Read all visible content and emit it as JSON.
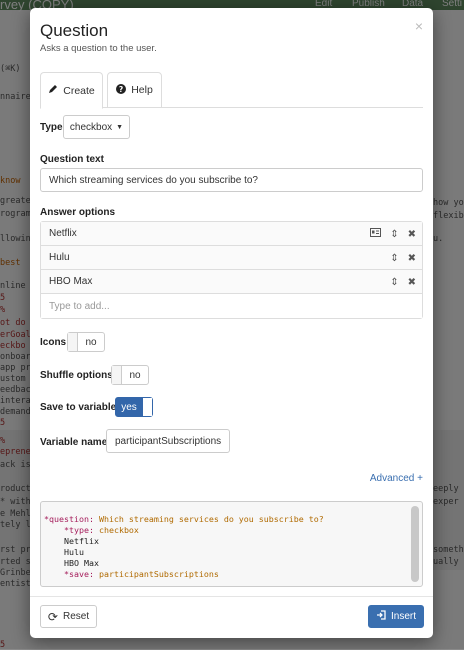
{
  "background": {
    "title": "rvey (COPY)",
    "nav": [
      "Edit",
      "Publish",
      "Data",
      "Setti"
    ],
    "shortcut": "(⌘K)",
    "fragments": [
      {
        "text": "nnaire",
        "cls": ""
      },
      {
        "text": "know",
        "cls": "orange"
      },
      {
        "text": "greate",
        "cls": ""
      },
      {
        "text": "rogram",
        "cls": ""
      },
      {
        "text": "llowin",
        "cls": ""
      },
      {
        "text": "best",
        "cls": "orange"
      },
      {
        "text": "nline",
        "cls": ""
      },
      {
        "text": "5",
        "cls": "red"
      },
      {
        "text": "%",
        "cls": "red"
      },
      {
        "text": "ot do",
        "cls": "red"
      },
      {
        "text": "erGoal",
        "cls": "red"
      },
      {
        "text": "eckbo",
        "cls": "red"
      },
      {
        "text": "onboar",
        "cls": ""
      },
      {
        "text": "app pr",
        "cls": ""
      },
      {
        "text": "ustom",
        "cls": ""
      },
      {
        "text": "eedbac",
        "cls": ""
      },
      {
        "text": "intera",
        "cls": ""
      },
      {
        "text": "demand",
        "cls": ""
      },
      {
        "text": "5",
        "cls": "red"
      },
      {
        "text": "%",
        "cls": "red"
      },
      {
        "text": "eprene",
        "cls": "red"
      },
      {
        "text": "ack is",
        "cls": ""
      },
      {
        "text": "roduct",
        "cls": ""
      },
      {
        "text": "* with",
        "cls": ""
      },
      {
        "text": "e Mehl",
        "cls": ""
      },
      {
        "text": "tely l",
        "cls": ""
      },
      {
        "text": "rst pr",
        "cls": ""
      },
      {
        "text": "rted s",
        "cls": ""
      },
      {
        "text": "Grinbe",
        "cls": ""
      },
      {
        "text": "entist",
        "cls": ""
      },
      {
        "text": "5",
        "cls": "red"
      }
    ],
    "right_fragments": [
      {
        "text": "how yo"
      },
      {
        "text": "flexib"
      },
      {
        "text": "u."
      },
      {
        "text": "eeply"
      },
      {
        "text": "exper"
      },
      {
        "text": "someth"
      },
      {
        "text": "ually"
      }
    ]
  },
  "modal": {
    "title": "Question",
    "subtitle": "Asks a question to the user.",
    "close_icon": "×",
    "tabs": [
      {
        "label": "Create",
        "icon": "pencil-icon",
        "active": true
      },
      {
        "label": "Help",
        "icon": "question-circle-icon",
        "active": false
      }
    ],
    "type": {
      "label": "Type",
      "value": "checkbox"
    },
    "question_text": {
      "label": "Question text",
      "value": "Which streaming services do you subscribe to?"
    },
    "answer_options": {
      "label": "Answer options",
      "items": [
        "Netflix",
        "Hulu",
        "HBO Max"
      ],
      "add_placeholder": "Type to add..."
    },
    "icons_toggle": {
      "label": "Icons",
      "value": "no"
    },
    "shuffle_toggle": {
      "label": "Shuffle options",
      "value": "no"
    },
    "save_toggle": {
      "label": "Save to variable",
      "value": "yes"
    },
    "variable_name": {
      "label": "Variable name",
      "value": "participantSubscriptions"
    },
    "advanced_link": "Advanced +",
    "code": {
      "question_key": "*question:",
      "question_val": " Which streaming services do you subscribe to?",
      "type_key": "*type:",
      "type_val": " checkbox",
      "options": [
        "Netflix",
        "Hulu",
        "HBO Max"
      ],
      "save_key": "*save:",
      "save_val": " participantSubscriptions"
    },
    "reset_button": "Reset",
    "insert_button": "Insert"
  },
  "colors": {
    "accent": "#3a6fb0",
    "toggle_on": "#3366aa",
    "topbar": "#5f8a5f",
    "code_keyword": "#a51d5b",
    "code_value": "#b06a00"
  }
}
